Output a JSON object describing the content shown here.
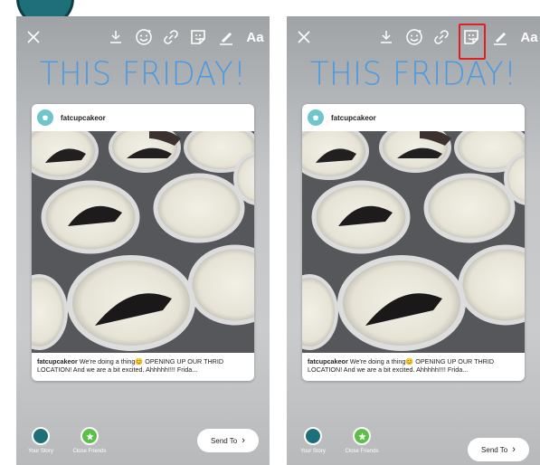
{
  "colors": {
    "headline": "#4a9ae3",
    "highlight": "#e02020",
    "close_friends": "#5bbf4a",
    "avatar": "#6fc5cc"
  },
  "toolbar": {
    "close_icon": "close-icon",
    "download_icon": "download-icon",
    "face_filter_icon": "face-effects-icon",
    "link_icon": "link-icon",
    "sticker_icon": "sticker-icon",
    "draw_icon": "pen-icon",
    "text_label": "Aa"
  },
  "left_panel": {
    "headline": "THIS FRIDAY!",
    "post": {
      "username": "fatcupcakeor",
      "caption_user": "fatcupcakeor",
      "caption_text": " We're doing a thing😊 OPENING UP OUR THRID LOCATION! And we are a bit excited. Ahhhhh!!!! Frida..."
    },
    "your_story": "Your Story",
    "close_friends": "Close Friends",
    "send_to": "Send To"
  },
  "right_panel": {
    "headline": "THIS FRIDAY!",
    "post": {
      "username": "fatcupcakeor",
      "caption_user": "fatcupcakeor",
      "caption_text": " We're doing a thing😊 OPENING UP OUR THRID LOCATION! And we are a bit excited. Ahhhhh!!!! Frida..."
    },
    "your_story": "Your Story",
    "close_friends": "Close Friends",
    "send_to": "Send To"
  }
}
